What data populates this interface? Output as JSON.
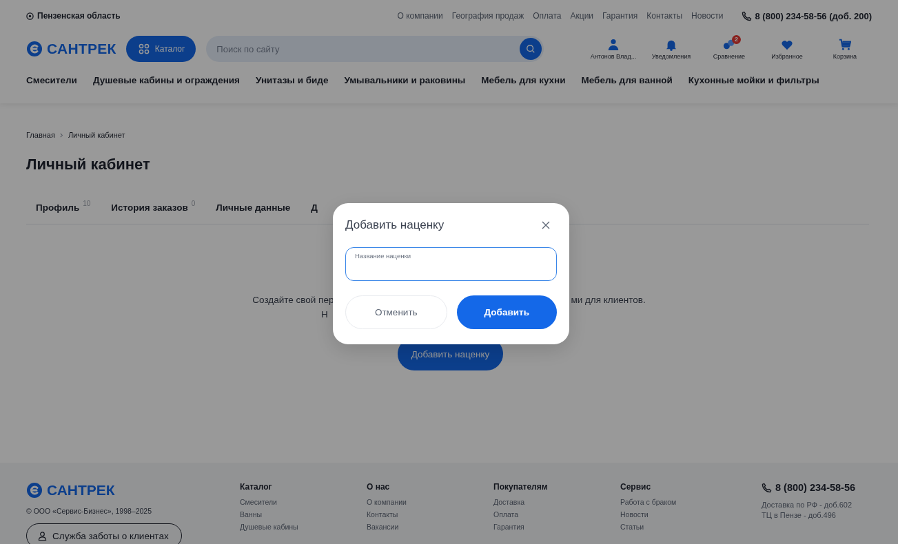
{
  "header": {
    "region": "Пензенская область",
    "top_links": [
      "О компании",
      "География продаж",
      "Оплата",
      "Акции",
      "Гарантия",
      "Контакты",
      "Новости"
    ],
    "phone": "8 (800) 234-58-56 (доб. 200)",
    "logo": "САНТРЕК",
    "catalog_button": "Каталог",
    "search": {
      "placeholder": "Поиск по сайту"
    },
    "actions": [
      {
        "kind": "user",
        "label": "Антонов Влад..."
      },
      {
        "kind": "bell",
        "label": "Уведомления"
      },
      {
        "kind": "compare",
        "label": "Сравнение",
        "badge": "2"
      },
      {
        "kind": "heart",
        "label": "Избранное"
      },
      {
        "kind": "cart",
        "label": "Корзина"
      }
    ],
    "categories": [
      "Смесители",
      "Душевые кабины и ограждения",
      "Унитазы и биде",
      "Умывальники и раковины",
      "Мебель для кухни",
      "Мебель для ванной",
      "Кухонные мойки и фильтры"
    ]
  },
  "breadcrumbs": [
    "Главная",
    "Личный кабинет"
  ],
  "page_title": "Личный кабинет",
  "tabs": [
    {
      "label": "Профиль",
      "count": "10",
      "selected": false
    },
    {
      "label": "История заказов",
      "count": "0",
      "selected": false
    },
    {
      "label": "Личные данные",
      "selected": false
    },
    {
      "label": "Д",
      "selected": false
    }
  ],
  "empty_state": {
    "text_left": "Создайте свой пер",
    "text_right": "ми для клиентов.",
    "text_line_2": "Н",
    "button": "Добавить наценку"
  },
  "modal": {
    "title": "Добавить наценку",
    "field": {
      "label": "Название наценки"
    },
    "cancel_button": "Отменить",
    "submit_button": "Добавить"
  },
  "footer": {
    "logo": "САНТРЕК",
    "copyright": "© ООО «Сервис-Бизнес», 1998–2025",
    "support_button": "Служба заботы о клиентах",
    "columns": [
      {
        "title": "Каталог",
        "links": [
          "Смесители",
          "Ванны",
          "Душевые кабины"
        ]
      },
      {
        "title": "О нас",
        "links": [
          "О компании",
          "Контакты",
          "Вакансии"
        ]
      },
      {
        "title": "Покупателям",
        "links": [
          "Доставка",
          "Оплата",
          "Гарантия"
        ]
      },
      {
        "title": "Сервис",
        "links": [
          "Работа с браком",
          "Новости",
          "Статьи"
        ]
      }
    ],
    "phone": "8 (800) 234-58-56",
    "notes": [
      "Доставка по РФ - доб.602",
      "ТЦ в Пензе - доб.496"
    ]
  }
}
